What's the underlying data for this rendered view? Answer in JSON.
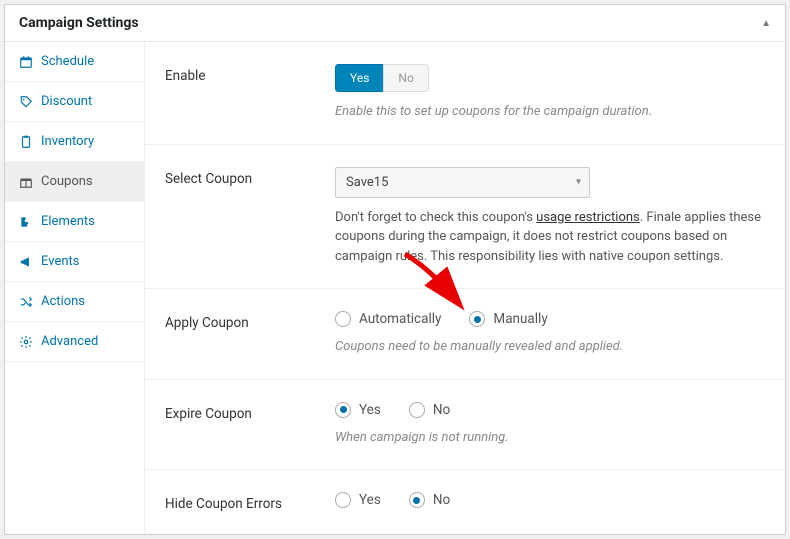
{
  "header": {
    "title": "Campaign Settings"
  },
  "sidebar": {
    "items": [
      {
        "label": "Schedule"
      },
      {
        "label": "Discount"
      },
      {
        "label": "Inventory"
      },
      {
        "label": "Coupons"
      },
      {
        "label": "Elements"
      },
      {
        "label": "Events"
      },
      {
        "label": "Actions"
      },
      {
        "label": "Advanced"
      }
    ]
  },
  "fields": {
    "enable": {
      "label": "Enable",
      "yes": "Yes",
      "no": "No",
      "help": "Enable this to set up coupons for the campaign duration."
    },
    "select_coupon": {
      "label": "Select Coupon",
      "value": "Save15",
      "desc_prefix": "Don't forget to check this coupon's ",
      "desc_link": "usage restrictions",
      "desc_suffix": ". Finale applies these coupons during the campaign, it does not restrict coupons based on campaign rules. This responsibility lies with native coupon settings."
    },
    "apply_coupon": {
      "label": "Apply Coupon",
      "opt_auto": "Automatically",
      "opt_manual": "Manually",
      "help": "Coupons need to be manually revealed and applied."
    },
    "expire_coupon": {
      "label": "Expire Coupon",
      "opt_yes": "Yes",
      "opt_no": "No",
      "help": "When campaign is not running."
    },
    "hide_errors": {
      "label": "Hide Coupon Errors",
      "opt_yes": "Yes",
      "opt_no": "No"
    }
  }
}
